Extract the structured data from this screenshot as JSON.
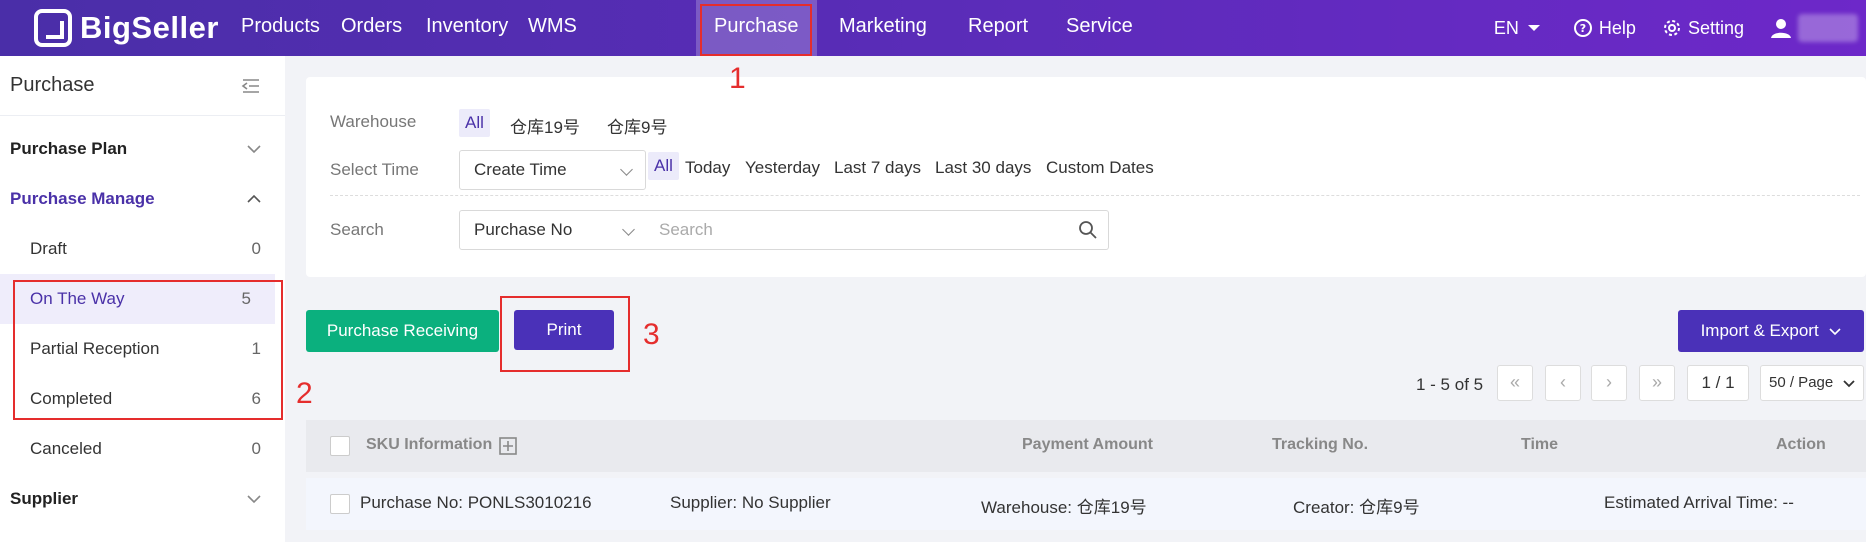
{
  "brand": {
    "name": "BigSeller"
  },
  "nav": {
    "items": [
      "Products",
      "Orders",
      "Inventory",
      "WMS",
      "Purchase",
      "Marketing",
      "Report",
      "Service"
    ],
    "active": "Purchase",
    "language": "EN",
    "help": "Help",
    "setting": "Setting"
  },
  "sidebar": {
    "title": "Purchase",
    "groups": {
      "plan": "Purchase Plan",
      "manage": "Purchase Manage",
      "supplier": "Supplier"
    },
    "items": [
      {
        "label": "Draft",
        "count": "0"
      },
      {
        "label": "On The Way",
        "count": "5"
      },
      {
        "label": "Partial Reception",
        "count": "1"
      },
      {
        "label": "Completed",
        "count": "6"
      },
      {
        "label": "Canceled",
        "count": "0"
      }
    ]
  },
  "filters": {
    "warehouse_label": "Warehouse",
    "warehouse_options": [
      "All",
      "仓库19号",
      "仓库9号"
    ],
    "time_label": "Select Time",
    "time_select": "Create Time",
    "time_options": [
      "All",
      "Today",
      "Yesterday",
      "Last 7 days",
      "Last 30 days",
      "Custom Dates"
    ],
    "search_label": "Search",
    "search_select": "Purchase No",
    "search_placeholder": "Search"
  },
  "actions": {
    "receive": "Purchase Receiving",
    "print": "Print",
    "import_export": "Import & Export"
  },
  "pagination": {
    "summary": "1 - 5 of 5",
    "page": "1 / 1",
    "page_size": "50 / Page"
  },
  "table": {
    "columns": [
      "SKU Information",
      "Payment Amount",
      "Tracking No.",
      "Time",
      "Action"
    ],
    "row": {
      "purchase_no": "Purchase No: PONLS3010216",
      "supplier": "Supplier: No Supplier",
      "warehouse": "Warehouse: 仓库19号",
      "creator": "Creator: 仓库9号",
      "arrival": "Estimated Arrival Time: --"
    }
  },
  "annotations": {
    "one": "1",
    "two": "2",
    "three": "3"
  },
  "colors": {
    "nav_bg": "#5a2cb8",
    "accent": "#4a31b8",
    "green": "#0bb07e",
    "annotation": "#e52d2d"
  }
}
